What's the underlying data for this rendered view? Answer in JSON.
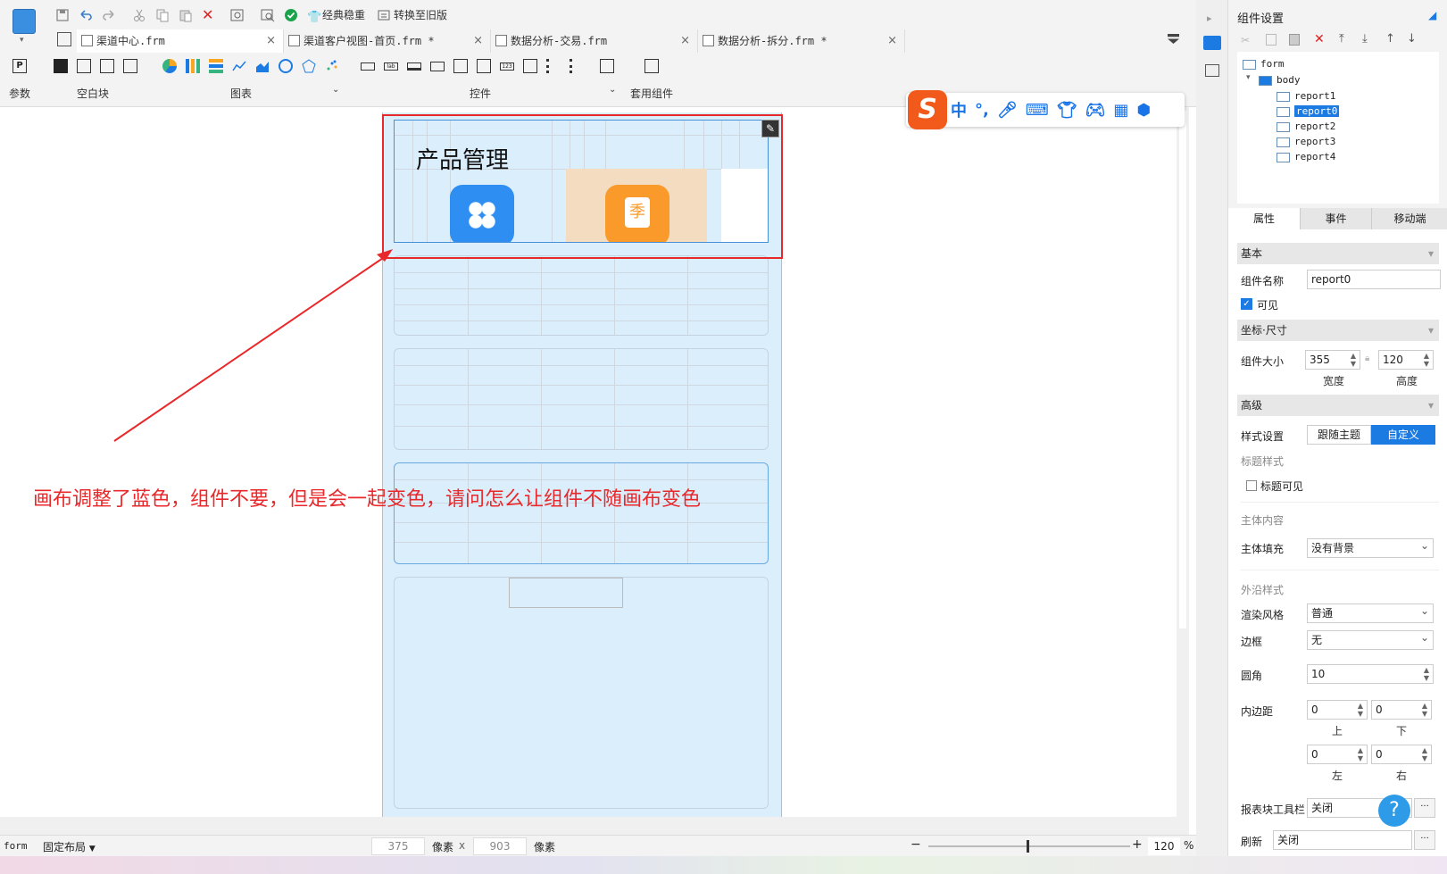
{
  "toolbar": {
    "classic_label": "经典稳重",
    "switch_label": "转换至旧版"
  },
  "tabs": [
    {
      "label": "渠道中心.frm",
      "close": "×"
    },
    {
      "label": "渠道客户视图-首页.frm *",
      "close": "×"
    },
    {
      "label": "数据分析-交易.frm",
      "close": "×"
    },
    {
      "label": "数据分析-拆分.frm *",
      "close": "×"
    }
  ],
  "ribbon": {
    "param_label": "参数",
    "blank_label": "空白块",
    "chart_label": "图表",
    "widget_label": "控件",
    "template_label": "套用组件"
  },
  "canvas": {
    "title_text": "产品管理",
    "annotation": "画布调整了蓝色，组件不要，但是会一起变色，请问怎么让组件不随画布变色",
    "tile_char": "季"
  },
  "ime": {
    "logo": "S",
    "lang": "中",
    "punct": "°,"
  },
  "right_panel": {
    "title": "组件设置",
    "tree": {
      "root": "form",
      "body": "body",
      "items": [
        "report1",
        "report0",
        "report2",
        "report3",
        "report4"
      ]
    },
    "tabs": [
      "属性",
      "事件",
      "移动端"
    ],
    "basic_section": "基本",
    "name_label": "组件名称",
    "name_value": "report0",
    "visible_label": "可见",
    "coord_section": "坐标·尺寸",
    "size_label": "组件大小",
    "width_value": "355",
    "height_value": "120",
    "width_caption": "宽度",
    "height_caption": "高度",
    "advanced_section": "高级",
    "style_label": "样式设置",
    "style_follow": "跟随主题",
    "style_custom": "自定义",
    "title_style_label": "标题样式",
    "title_visible_label": "标题可见",
    "body_content_label": "主体内容",
    "body_fill_label": "主体填充",
    "body_fill_value": "没有背景",
    "edge_style_label": "外沿样式",
    "render_label": "渲染风格",
    "render_value": "普通",
    "border_label": "边框",
    "border_value": "无",
    "radius_label": "圆角",
    "radius_value": "10",
    "padding_label": "内边距",
    "pad_top": "0",
    "pad_bottom": "0",
    "pad_left": "0",
    "pad_right": "0",
    "cap_top": "上",
    "cap_bottom": "下",
    "cap_left": "左",
    "cap_right": "右",
    "toolbar_label": "报表块工具栏",
    "toolbar_value": "关闭",
    "refresh_label": "刷新",
    "refresh_value": "关闭",
    "help": "?",
    "more": "···"
  },
  "status": {
    "form_label": "form",
    "layout_label": "固定布局",
    "width_value": "375",
    "px_label": "像素",
    "times": "x",
    "height_value": "903",
    "px_label2": "像素",
    "minus": "−",
    "plus": "+",
    "zoom": "120",
    "percent": "%"
  },
  "colors": {
    "accent": "#1c7be3",
    "canvas_bg": "#dbeefc",
    "annotation": "#e8282a"
  }
}
